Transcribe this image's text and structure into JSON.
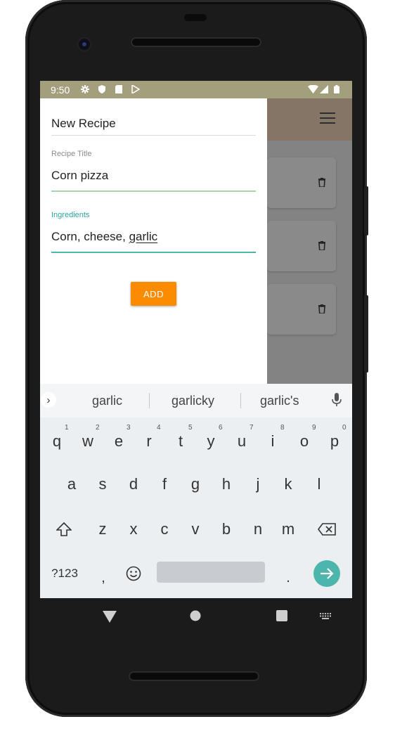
{
  "status_bar": {
    "time": "9:50"
  },
  "drawer": {
    "title": "New Recipe",
    "recipe_title": {
      "label": "Recipe Title",
      "value": "Corn pizza"
    },
    "ingredients": {
      "label": "Ingredients",
      "value_prefix": "Corn, cheese, ",
      "value_current_word": "garlic"
    },
    "add_label": "ADD"
  },
  "keyboard": {
    "suggestions": [
      "garlic",
      "garlicky",
      "garlic's"
    ],
    "row1": [
      "q",
      "w",
      "e",
      "r",
      "t",
      "y",
      "u",
      "i",
      "o",
      "p"
    ],
    "row1_numbers": [
      "1",
      "2",
      "3",
      "4",
      "5",
      "6",
      "7",
      "8",
      "9",
      "0"
    ],
    "row2": [
      "a",
      "s",
      "d",
      "f",
      "g",
      "h",
      "j",
      "k",
      "l"
    ],
    "row3": [
      "z",
      "x",
      "c",
      "v",
      "b",
      "n",
      "m"
    ],
    "symbols_label": "?123",
    "comma": ",",
    "period": "."
  },
  "colors": {
    "status_bar": "#a39e7c",
    "app_bar": "#f5d8bd",
    "accent_teal": "#26a69a",
    "add_button": "#fb8c00",
    "keyboard_bg": "#eceff1"
  },
  "icons": [
    "settings-icon",
    "shield-icon",
    "sd-card-icon",
    "play-store-icon",
    "wifi-icon",
    "signal-icon",
    "battery-icon",
    "menu-icon",
    "trash-icon",
    "chevron-right-icon",
    "mic-icon",
    "shift-icon",
    "backspace-icon",
    "emoji-icon",
    "enter-arrow-icon",
    "back-nav-icon",
    "home-nav-icon",
    "recents-nav-icon",
    "keyboard-switch-icon"
  ]
}
